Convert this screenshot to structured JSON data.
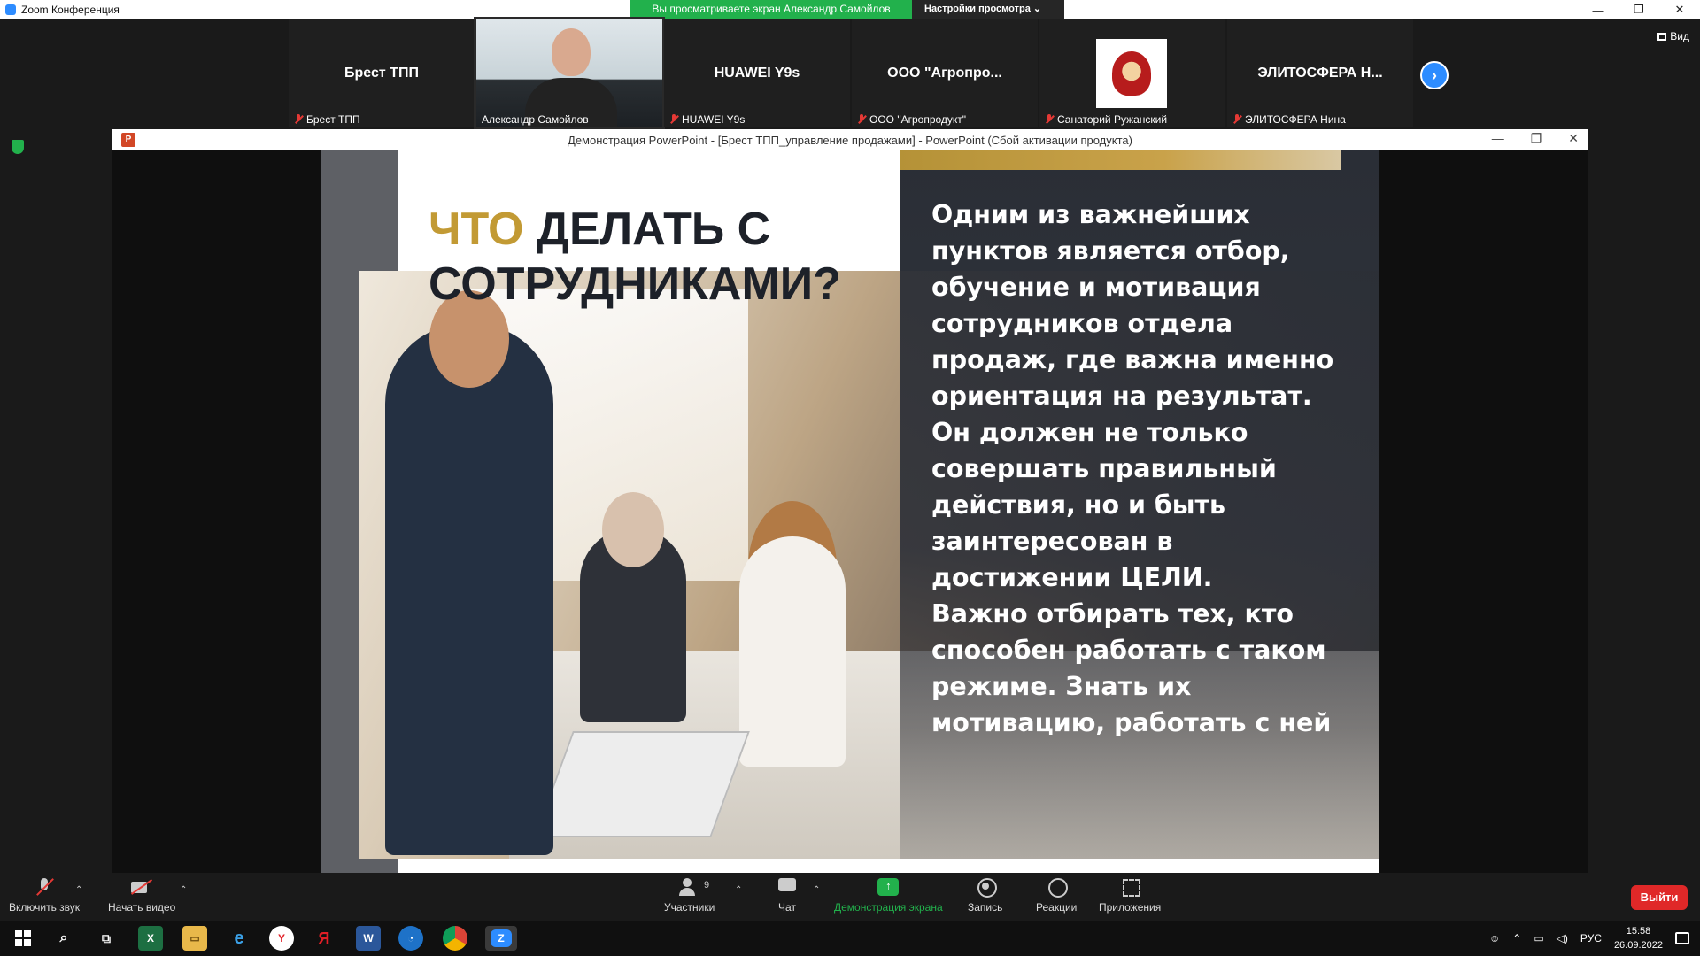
{
  "titlebar": {
    "app_title": "Zoom Конференция",
    "share_banner": "Вы просматриваете экран Александр Самойлов",
    "view_options": "Настройки просмотра ⌄",
    "minimize": "—",
    "restore": "❐",
    "close": "✕"
  },
  "gallery": {
    "tiles": [
      {
        "big_label": "Брест ТПП",
        "name": "Брест ТПП"
      },
      {
        "big_label": "",
        "name": "Александр Самойлов"
      },
      {
        "big_label": "HUAWEI Y9s",
        "name": "HUAWEI Y9s"
      },
      {
        "big_label": "ООО  \"Агропро...",
        "name": "ООО \"Агропродукт\""
      },
      {
        "big_label": "",
        "name": "Санаторий Ружанский"
      },
      {
        "big_label": "ЭЛИТОСФЕРА  Н...",
        "name": "ЭЛИТОСФЕРА Нина"
      }
    ],
    "next_arrow": "›",
    "view_label": "Вид"
  },
  "ppt": {
    "window_title": "Демонстрация PowerPoint - [Брест ТПП_управление продажами] - PowerPoint (Сбой активации продукта)",
    "icon_letter": "P",
    "controls": {
      "minimize": "—",
      "restore": "❐",
      "close": "✕"
    },
    "slide": {
      "title_accent": "ЧТО",
      "title_rest": " ДЕЛАТЬ С СОТРУДНИКАМИ?",
      "body_p1": "Одним из важнейших пунктов является отбор, обучение и мотивация сотрудников отдела продаж, где важна именно ориентация на результат. Он должен не только совершать правильный действия, но и быть заинтересован в достижении ЦЕЛИ.",
      "body_p2": "Важно отбирать тех, кто способен работать с таком режиме. Знать их мотивацию, работать с ней"
    }
  },
  "controls": {
    "unmute": "Включить звук",
    "start_video": "Начать видео",
    "participants": "Участники",
    "participants_count": "9",
    "chat": "Чат",
    "share_screen": "Демонстрация экрана",
    "record": "Запись",
    "reactions": "Реакции",
    "apps": "Приложения",
    "leave": "Выйти",
    "caret": "⌃"
  },
  "taskbar": {
    "apps": [
      "X",
      "e",
      "Y",
      "Я",
      "W",
      "Z"
    ],
    "tray_lang": "РУС",
    "time": "15:58",
    "date": "26.09.2022"
  },
  "colors": {
    "zoom_blue": "#2D8CFF",
    "share_green": "#22b14c",
    "leave_red": "#e02828",
    "slide_gold": "#c29a34"
  }
}
